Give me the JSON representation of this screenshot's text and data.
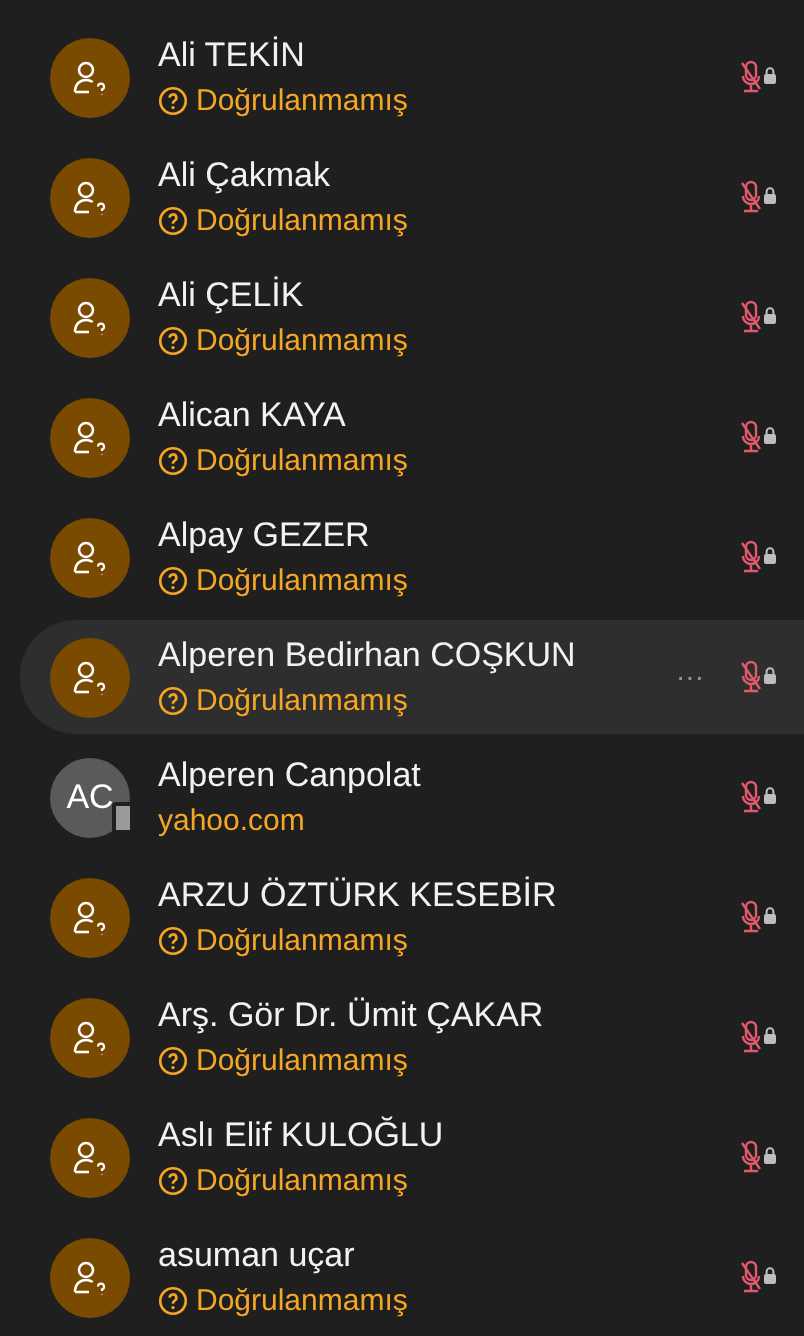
{
  "contacts": [
    {
      "kind": "unverified",
      "name": "Ali TEKİN",
      "status": "Doğrulanmamış",
      "selected": false
    },
    {
      "kind": "unverified",
      "name": "Ali Çakmak",
      "status": "Doğrulanmamış",
      "selected": false
    },
    {
      "kind": "unverified",
      "name": "Ali ÇELİK",
      "status": "Doğrulanmamış",
      "selected": false
    },
    {
      "kind": "unverified",
      "name": "Alican KAYA",
      "status": "Doğrulanmamış",
      "selected": false
    },
    {
      "kind": "unverified",
      "name": "Alpay GEZER",
      "status": "Doğrulanmamış",
      "selected": false
    },
    {
      "kind": "unverified",
      "name": "Alperen Bedirhan COŞKUN",
      "status": "Doğrulanmamış",
      "selected": true,
      "more": "···"
    },
    {
      "kind": "account",
      "initials": "AC",
      "name": "Alperen Canpolat",
      "domain": "yahoo.com",
      "selected": false
    },
    {
      "kind": "unverified",
      "name": "ARZU ÖZTÜRK KESEBİR",
      "status": "Doğrulanmamış",
      "selected": false
    },
    {
      "kind": "unverified",
      "name": "Arş. Gör Dr. Ümit ÇAKAR",
      "status": "Doğrulanmamış",
      "selected": false
    },
    {
      "kind": "unverified",
      "name": "Aslı Elif KULOĞLU",
      "status": "Doğrulanmamış",
      "selected": false
    },
    {
      "kind": "unverified",
      "name": "asuman uçar",
      "status": "Doğrulanmamış",
      "selected": false
    }
  ]
}
